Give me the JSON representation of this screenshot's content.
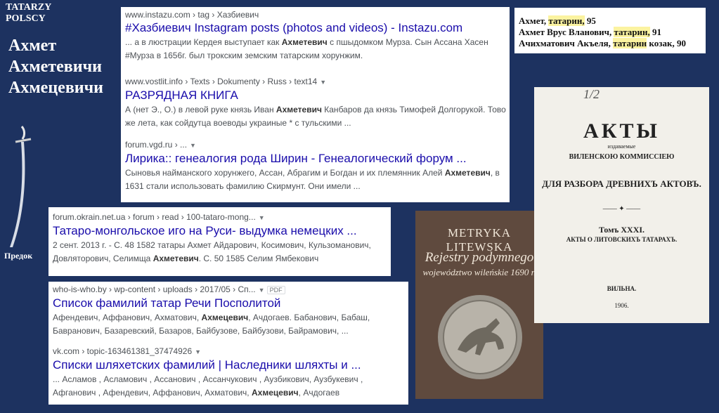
{
  "brand": {
    "line1": "TATARZY",
    "line2": "POLSCY"
  },
  "surnames": [
    "Ахмет",
    "Ахметевичи",
    "Ахмецевичи"
  ],
  "ancestor_label": "Предок",
  "results_a": [
    {
      "url": "www.instazu.com › tag › Хазбиевич",
      "title": "#Хазбиевич Instagram posts (photos and videos) - Instazu.com",
      "snippet_1": "... а в люстрации Кердея выступает как ",
      "snippet_bold": "Ахметевич",
      "snippet_2": " с пшыдомком Мурза. Сын Ассана Хасен #Мурза в 1656г. был трокским земским татарским хорунжим."
    },
    {
      "url": "www.vostlit.info › Texts › Dokumenty › Russ › text14",
      "title": "РАЗРЯДНАЯ КНИГА",
      "snippet_1": "А (нет Э., О.) в левой руке князь Иван ",
      "snippet_bold": "Ахметевич",
      "snippet_2": " Канбаров да князь Тимофей Долгорукой. Тово же лета, как сойдутца воеводы украиные * с тульскими ..."
    },
    {
      "url": "forum.vgd.ru › ...",
      "title": "Лирика:: генеалогия рода Ширин - Генеалогический форум ...",
      "snippet_1": "Сыновья найманского хорунжего, Ассан, Абрагим и Богдан и их племянник Алей ",
      "snippet_bold": "Ахметевич",
      "snippet_2": ", в 1631 стали использовать фамилию Скирмунт. Они имели ..."
    }
  ],
  "result_b": {
    "url": "forum.okrain.net.ua › forum › read › 100-tataro-mong...",
    "title": "Татаро-монгольское иго на Руси- выдумка немецких ...",
    "snippet_1": "2 сент. 2013 г. - С. 48 1582 татары Ахмет Айдарович, Косимович, Кульзоманович, Довляторович, Селимща ",
    "snippet_bold": "Ахметевич",
    "snippet_2": ". С. 50 1585 Селим Ямбекович"
  },
  "results_c": [
    {
      "url": "who-is-who.by › wp-content › uploads › 2017/05 › Сп...",
      "badge": "PDF",
      "title": "Список фамилий татар Речи Посполитой",
      "snippet_1": "Афендевич, Аффанович, Ахматович, ",
      "snippet_bold": "Ахмецевич",
      "snippet_2": ", Ачдогаев. Бабанович, Бабаш, Бавранович, Базаревский, Базаров, Байбузове, Байбузови, Байрамович, ..."
    },
    {
      "url": "vk.com › topic-163461381_37474926",
      "title": "Списки шляхетских фамилий | Наследники шляхты и ...",
      "snippet_1": "... Асламов , Асламович , Ассанович , Ассанчукович , Аузбикович, Аузбукевич , Афганович , Афендевич, Аффанович, Ахматович, ",
      "snippet_bold": "Ахмецевич",
      "snippet_2": ", Ачдогаев"
    }
  ],
  "register": [
    {
      "name": "Ахмет, ",
      "hl": "татарин,",
      "rest": " 95"
    },
    {
      "name": "Ахмет Врус Вланович, ",
      "hl": "татарин,",
      "rest": " 91"
    },
    {
      "name": "Ачихматович Акъеля, ",
      "hl": "татарин",
      "rest": " козак, 90"
    }
  ],
  "book": {
    "title": "METRYKA LITEWSKA",
    "sub1": "Rejestry podymnego",
    "sub2": "województwo wileńskie 1690 r."
  },
  "title_page": {
    "handwritten": "1/2",
    "title": "АКТЫ",
    "small": "издаваемые",
    "line1": "ВИЛЕНСКОЮ КОММИССІЕЮ",
    "line2": "ДЛЯ РАЗБОРА ДРЕВНИХЪ АКТОВЪ.",
    "volume": "Томъ XXXI.",
    "subtitle": "АКТЫ О ЛИТОВСКИХЪ ТАТАРАХЪ.",
    "city": "ВИЛЬНА.",
    "year": "1906."
  },
  "colors": {
    "background": "#1d3260",
    "link": "#1a0dab",
    "highlight": "#fbf3a0",
    "book_cover": "#5f4a3e"
  }
}
